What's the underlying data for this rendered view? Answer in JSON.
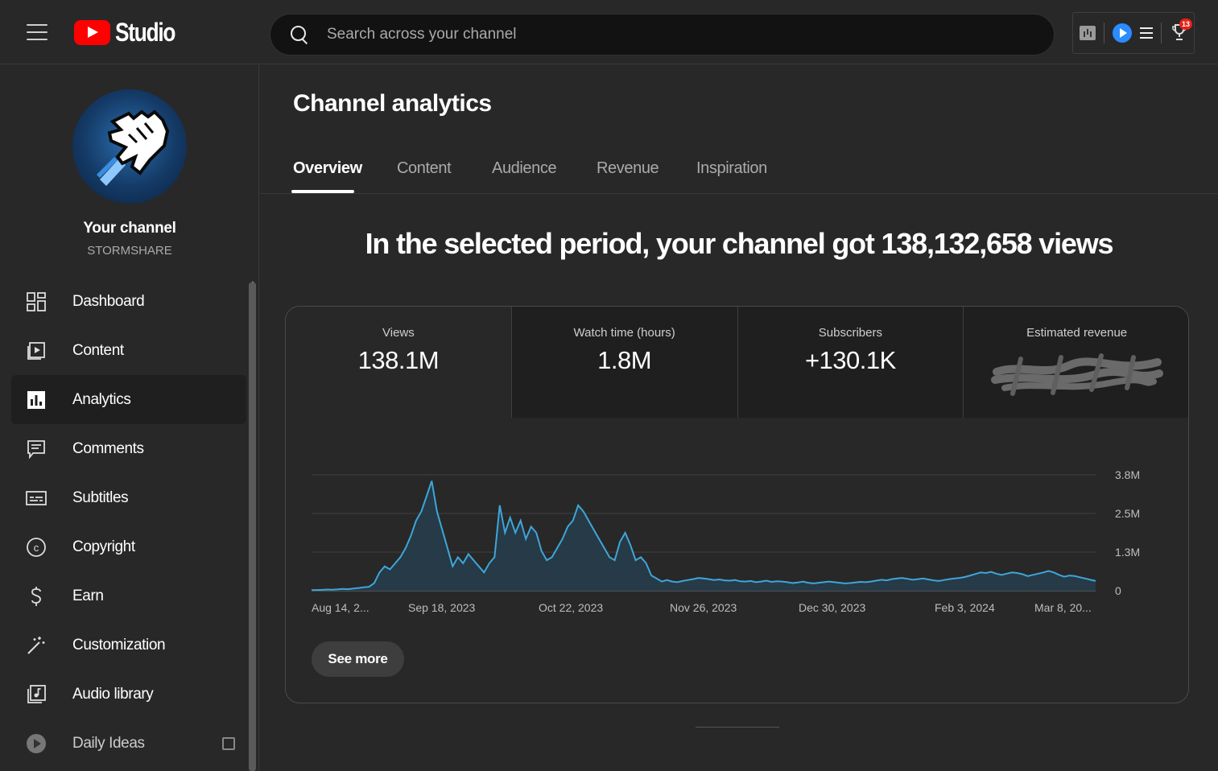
{
  "header": {
    "logo_text": "Studio",
    "search_placeholder": "Search across your channel",
    "notification_count": "13",
    "icons": [
      "menu-icon",
      "youtube-logo-icon",
      "search-icon",
      "extension-chart-icon",
      "extension-play-icon",
      "extension-menu-icon",
      "trophy-icon"
    ]
  },
  "sidebar": {
    "channel_label": "Your channel",
    "channel_handle": "STORMSHARE",
    "items": [
      {
        "label": "Dashboard",
        "icon": "dashboard-icon"
      },
      {
        "label": "Content",
        "icon": "content-icon"
      },
      {
        "label": "Analytics",
        "icon": "analytics-icon",
        "active": true
      },
      {
        "label": "Comments",
        "icon": "comments-icon"
      },
      {
        "label": "Subtitles",
        "icon": "subtitles-icon"
      },
      {
        "label": "Copyright",
        "icon": "copyright-icon"
      },
      {
        "label": "Earn",
        "icon": "earn-icon"
      },
      {
        "label": "Customization",
        "icon": "customization-icon"
      },
      {
        "label": "Audio library",
        "icon": "audio-library-icon"
      },
      {
        "label": "Daily Ideas",
        "icon": "daily-ideas-icon",
        "external": true
      }
    ]
  },
  "main": {
    "title": "Channel analytics",
    "tabs": [
      {
        "label": "Overview",
        "active": true
      },
      {
        "label": "Content"
      },
      {
        "label": "Audience"
      },
      {
        "label": "Revenue"
      },
      {
        "label": "Inspiration"
      }
    ],
    "headline": "In the selected period, your channel got 138,132,658 views",
    "metrics": [
      {
        "label": "Views",
        "value": "138.1M",
        "active": true
      },
      {
        "label": "Watch time (hours)",
        "value": "1.8M"
      },
      {
        "label": "Subscribers",
        "value": "+130.1K"
      },
      {
        "label": "Estimated revenue",
        "value": "",
        "redacted": true
      }
    ],
    "see_more_label": "See more"
  },
  "colors": {
    "background": "#282828",
    "line": "#3ea6d8",
    "area": "#263a48",
    "accent_red": "#ff0000"
  },
  "chart_data": {
    "type": "area",
    "series": [
      {
        "name": "Views",
        "values": [
          20000,
          25000,
          30000,
          40000,
          35000,
          45000,
          60000,
          50000,
          70000,
          90000,
          110000,
          130000,
          250000,
          600000,
          800000,
          700000,
          900000,
          1100000,
          1400000,
          1800000,
          2300000,
          2600000,
          3100000,
          3600000,
          2600000,
          2000000,
          1400000,
          800000,
          1100000,
          900000,
          1200000,
          1000000,
          800000,
          600000,
          900000,
          1100000,
          2800000,
          1900000,
          2400000,
          1900000,
          2300000,
          1700000,
          2100000,
          1900000,
          1300000,
          1000000,
          1100000,
          1400000,
          1700000,
          2100000,
          2300000,
          2800000,
          2600000,
          2300000,
          2000000,
          1700000,
          1400000,
          1100000,
          1000000,
          1600000,
          1900000,
          1500000,
          1000000,
          1100000,
          900000,
          500000,
          400000,
          300000,
          350000,
          300000,
          280000,
          320000,
          350000,
          380000,
          420000,
          400000,
          380000,
          350000,
          370000,
          340000,
          330000,
          350000,
          310000,
          300000,
          320000,
          280000,
          300000,
          330000,
          290000,
          310000,
          300000,
          280000,
          250000,
          270000,
          300000,
          260000,
          240000,
          260000,
          280000,
          300000,
          280000,
          260000,
          240000,
          250000,
          270000,
          290000,
          280000,
          300000,
          330000,
          360000,
          340000,
          380000,
          400000,
          420000,
          390000,
          360000,
          380000,
          400000,
          370000,
          340000,
          320000,
          350000,
          380000,
          400000,
          420000,
          450000,
          500000,
          550000,
          600000,
          580000,
          620000,
          560000,
          520000,
          560000,
          600000,
          580000,
          540000,
          480000,
          520000,
          560000,
          600000,
          650000,
          600000,
          520000,
          460000,
          500000,
          480000,
          440000,
          400000,
          360000,
          320000
        ]
      }
    ],
    "x_tick_labels": [
      "Aug 14, 2...",
      "Sep 18, 2023",
      "Oct 22, 2023",
      "Nov 26, 2023",
      "Dec 30, 2023",
      "Feb 3, 2024",
      "Mar 8, 20..."
    ],
    "y_tick_labels": [
      "3.8M",
      "2.5M",
      "1.3M",
      "0"
    ],
    "ylim": [
      0,
      3800000
    ],
    "grid": true
  }
}
